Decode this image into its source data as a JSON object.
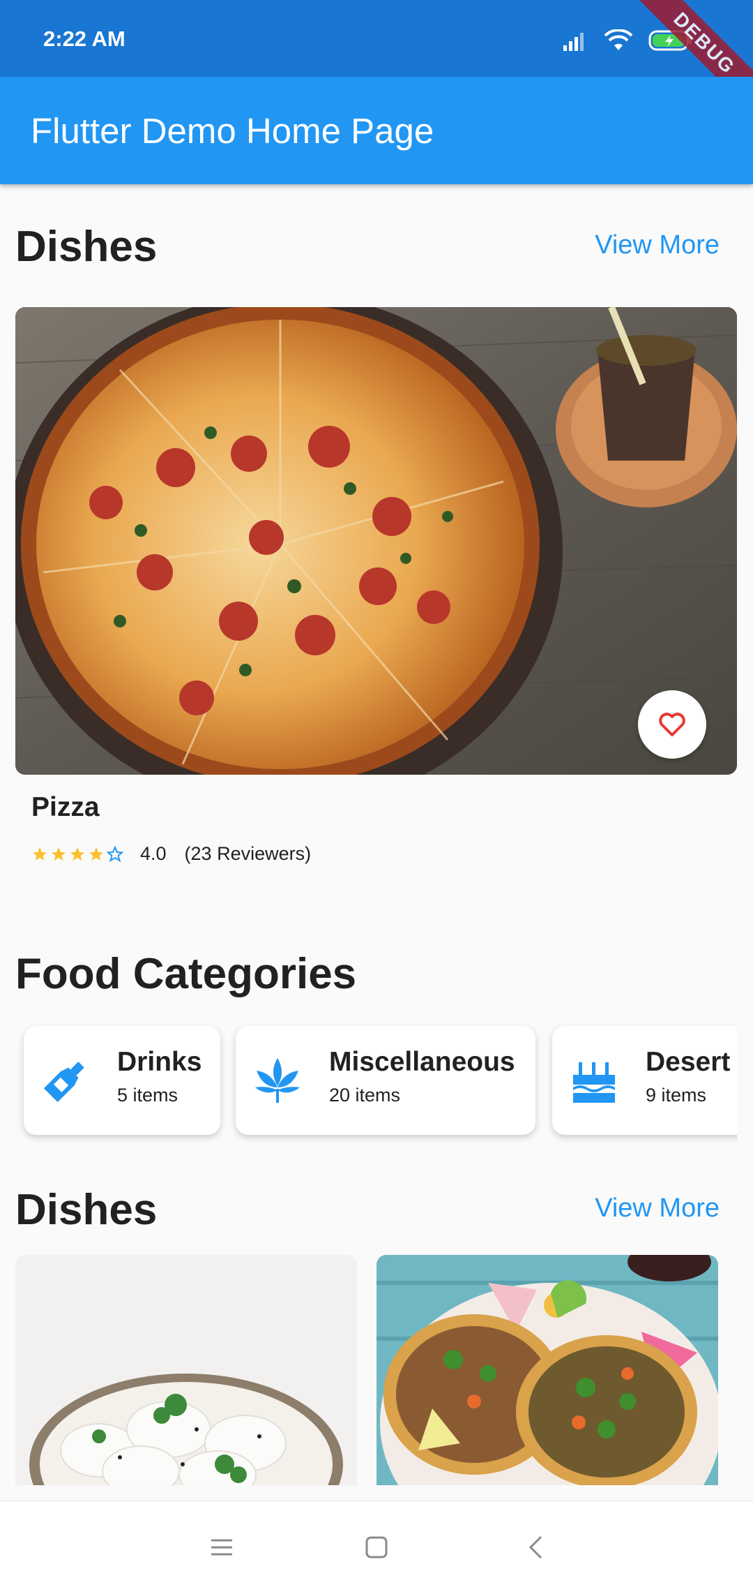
{
  "status_bar": {
    "time": "2:22 AM",
    "debug_label": "DEBUG"
  },
  "app_bar": {
    "title": "Flutter Demo Home Page"
  },
  "section1": {
    "title": "Dishes",
    "view_more": "View More"
  },
  "featured": {
    "name": "Pizza",
    "rating": "4.0",
    "reviewers": "(23 Reviewers)",
    "rating_value": 4,
    "rating_max": 5
  },
  "categories_section": {
    "title": "Food Categories",
    "items": [
      {
        "name": "Drinks",
        "count": "5 items",
        "icon": "bottle-icon"
      },
      {
        "name": "Miscellaneous",
        "count": "20 items",
        "icon": "leaf-icon"
      },
      {
        "name": "Desert",
        "count": "9 items",
        "icon": "cake-icon"
      }
    ]
  },
  "section2": {
    "title": "Dishes",
    "view_more": "View More"
  },
  "colors": {
    "primary": "#2196f3",
    "status_bar": "#1976d2",
    "star": "#fbc02d",
    "favorite": "#e53935"
  }
}
